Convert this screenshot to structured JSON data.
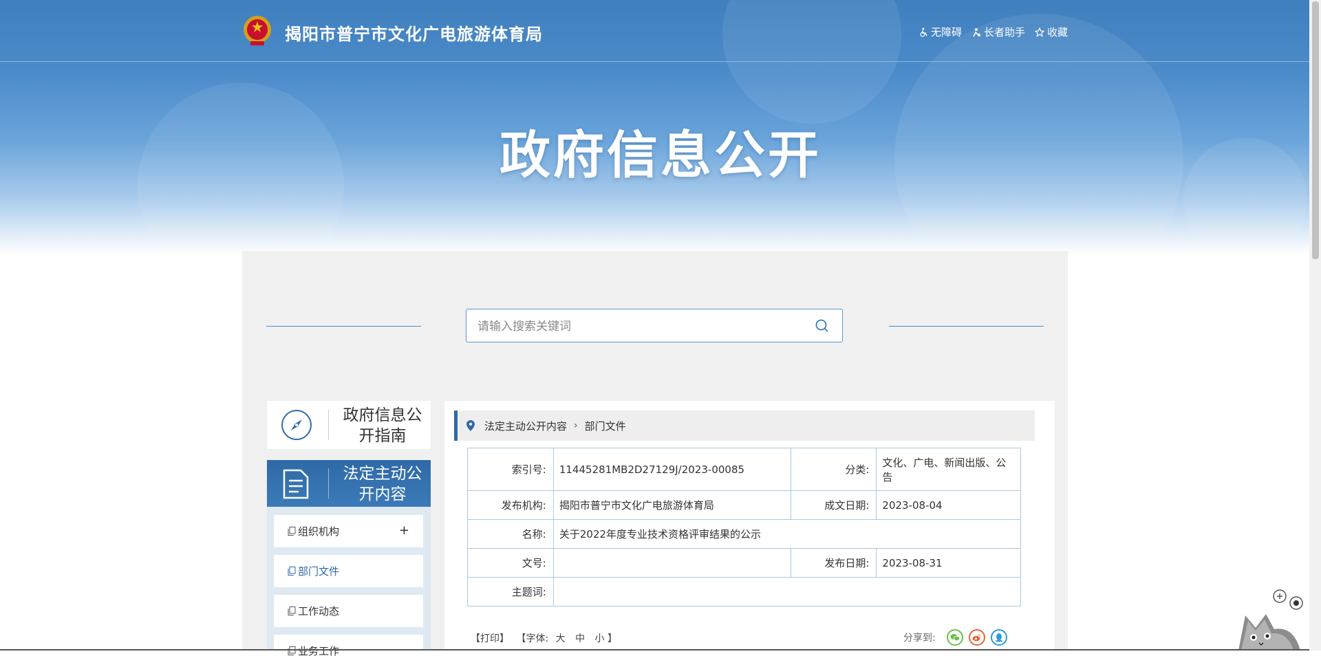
{
  "header": {
    "site_name": "揭阳市普宁市文化广电旅游体育局",
    "tools": [
      {
        "icon": "wheelchair-icon",
        "label": "无障碍"
      },
      {
        "icon": "elder-icon",
        "label": "长者助手"
      },
      {
        "icon": "star-icon",
        "label": "收藏"
      }
    ]
  },
  "hero": {
    "title": "政府信息公开"
  },
  "search": {
    "placeholder": "请输入搜索关键词"
  },
  "sidebar": {
    "guide_label": "政府信息公开指南",
    "law_label": "法定主动公开内容",
    "menu": [
      {
        "label": "组织机构",
        "has_expand": true,
        "expand_symbol": "+"
      },
      {
        "label": "部门文件",
        "active": true
      },
      {
        "label": "工作动态"
      },
      {
        "label": "业务工作"
      }
    ]
  },
  "breadcrumb": [
    "法定主动公开内容",
    "部门文件"
  ],
  "meta": {
    "index_label": "索引号:",
    "index_value": "11445281MB2D27129J/2023-00085",
    "category_label": "分类:",
    "category_value": "文化、广电、新闻出版、公告",
    "publisher_label": "发布机构:",
    "publisher_value": "揭阳市普宁市文化广电旅游体育局",
    "created_label": "成文日期:",
    "created_value": "2023-08-04",
    "name_label": "名称:",
    "name_value": "关于2022年度专业技术资格评审结果的公示",
    "docno_label": "文号:",
    "docno_value": "",
    "pubdate_label": "发布日期:",
    "pubdate_value": "2023-08-31",
    "subject_label": "主题词:",
    "subject_value": ""
  },
  "footer_tools": {
    "print": "【打印】",
    "font_prefix": "【字体:",
    "font_large": "大",
    "font_medium": "中",
    "font_small": "小",
    "font_suffix": "】",
    "share_label": "分享到:"
  },
  "colors": {
    "accent": "#2f6aa7",
    "wechat": "#6cc04a",
    "weibo": "#e8643b",
    "qq": "#2a9be0"
  }
}
